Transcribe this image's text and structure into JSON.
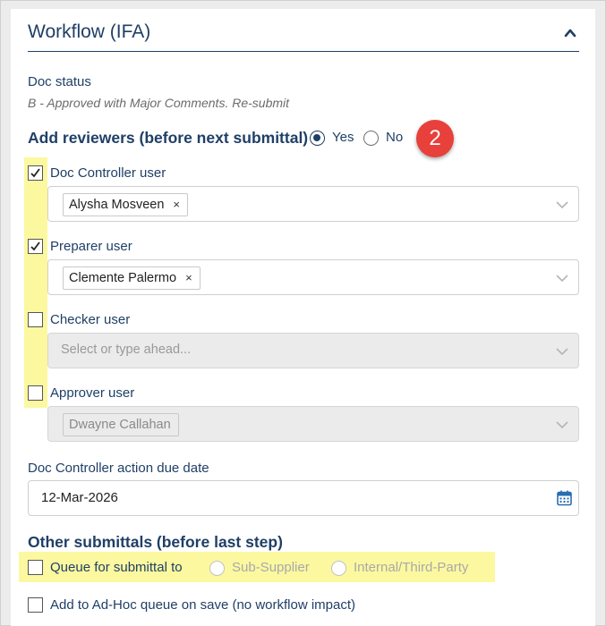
{
  "header": {
    "title": "Workflow (IFA)"
  },
  "doc_status": {
    "label": "Doc status",
    "value": "B - Approved with Major Comments. Re-submit"
  },
  "add_reviewers": {
    "title": "Add reviewers (before next submittal)",
    "yes_label": "Yes",
    "no_label": "No",
    "selected": "Yes",
    "badge": "2"
  },
  "reviewers": [
    {
      "label": "Doc Controller user",
      "checked": true,
      "chip": "Alysha Mosveen",
      "placeholder": "",
      "disabled": false
    },
    {
      "label": "Preparer user",
      "checked": true,
      "chip": "Clemente Palermo",
      "placeholder": "",
      "disabled": false
    },
    {
      "label": "Checker user",
      "checked": false,
      "chip": "",
      "placeholder": "Select or type ahead...",
      "disabled": true
    },
    {
      "label": "Approver user",
      "checked": false,
      "chip": "Dwayne Callahan",
      "placeholder": "",
      "disabled": true
    }
  ],
  "chip_remove": "×",
  "due_date": {
    "label": "Doc Controller action due date",
    "value": "12-Mar-2026"
  },
  "other_submittals": {
    "title": "Other submittals (before last step)",
    "queue_label": "Queue for submittal to",
    "option_sub_supplier": "Sub-Supplier",
    "option_internal": "Internal/Third-Party",
    "adhoc_label": "Add to Ad-Hoc queue on save (no workflow impact)"
  },
  "colors": {
    "primary": "#1f3f66",
    "highlight": "#fcf8a0",
    "badge": "#e8403a"
  }
}
